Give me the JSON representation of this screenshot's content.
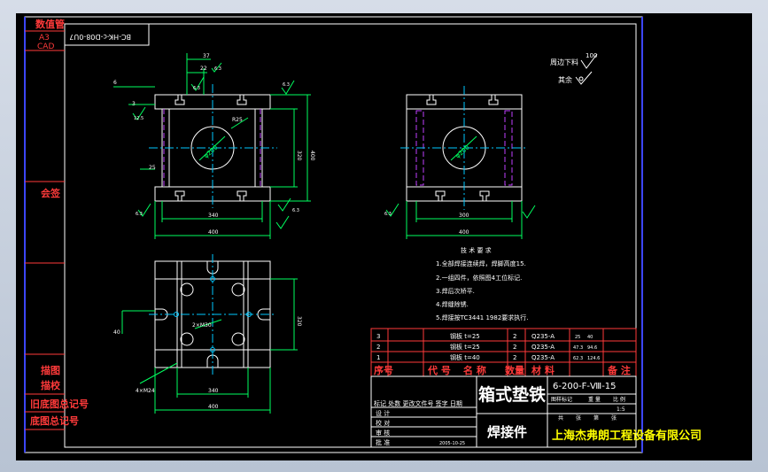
{
  "sheet": {
    "drawing_no": "BC-HK-c-D08-0U7",
    "sheet_label": "数值管",
    "paper_size": "A3",
    "cad_label": "CAD"
  },
  "left_strip": {
    "sign_label": "会签",
    "labels": [
      "描图",
      "描校",
      "旧底图总记号",
      "底图总记号"
    ]
  },
  "roughness": {
    "label_right": "周边下料",
    "value_right": "100",
    "label_rest": "其余"
  },
  "tech_requirements": {
    "title": "技 术 要 求",
    "items": [
      "1.全部焊接连续焊，焊脚高度15.",
      "2.一组四件，依照图4工位标记.",
      "3.焊后次矫平.",
      "4.焊缝除锈.",
      "5.焊接按TC3441 1982要求执行."
    ]
  },
  "bom": {
    "rows": [
      {
        "no": "3",
        "name": "钢板 t=25",
        "qty": "2",
        "mat": "Q235-A",
        "w1": "25",
        "w2": "40"
      },
      {
        "no": "2",
        "name": "钢板 t=25",
        "qty": "2",
        "mat": "Q235-A",
        "w1": "47.3",
        "w2": "94.6"
      },
      {
        "no": "1",
        "name": "钢板 t=40",
        "qty": "2",
        "mat": "Q235-A",
        "w1": "62.3",
        "w2": "124.6"
      }
    ],
    "header": [
      "序号",
      "代 号",
      "名 称",
      "数量",
      "材 料",
      "备 注"
    ]
  },
  "title_block": {
    "part_name": "箱式垫铁",
    "doc_code": "6-200-F-Ⅷ-15",
    "proc_name": "焊接件",
    "company": "上海杰弗朗工程设备有限公司",
    "stage_labels": [
      "图样标记",
      "重 量",
      "比 例"
    ],
    "scale": "1:5",
    "sheet_count": [
      "共",
      "张",
      "第",
      "张"
    ],
    "sign_rows": [
      "标记 处数 更改文件号 签字 日期",
      "设 计",
      "校 对",
      "审 核",
      "批 准"
    ],
    "date": "2005-10-25"
  },
  "dims": {
    "front_width_inner": "340",
    "front_width_outer": "400",
    "front_height_inner": "320",
    "front_height_outer": "400",
    "side_width_inner": "300",
    "side_width_outer": "400",
    "bottom_width_inner": "340",
    "bottom_width_outer": "400",
    "bottom_height": "320",
    "bolt_label": "4×M24",
    "dia_label": "φ200",
    "hole_label": "2×M30",
    "dim_37": "37",
    "dim_22": "22",
    "dim_25": "25",
    "dim_r25": "R25",
    "dim_6": "6",
    "dim_3": "3",
    "rough_12": "12.5",
    "rough_63": "6.3",
    "left_dim": "40"
  }
}
